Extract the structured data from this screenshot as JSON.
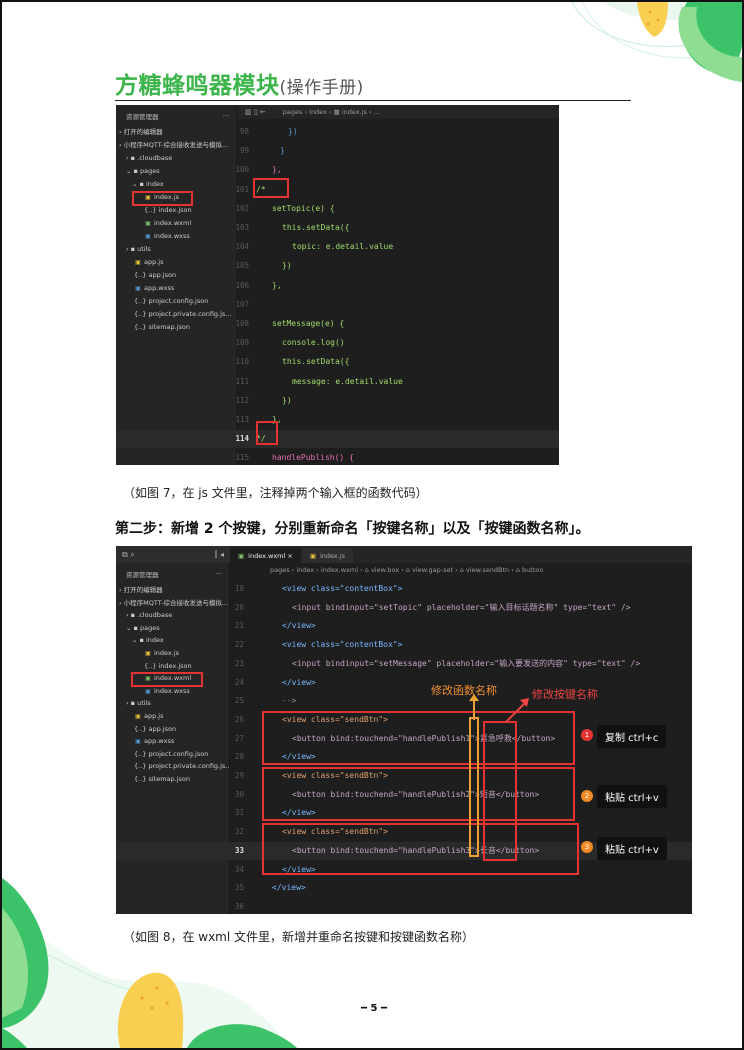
{
  "header": {
    "title": "方糖蜂鸣器模块",
    "subtitle": "(操作手册)"
  },
  "figure1": {
    "explorer_title": "资源管理器",
    "explorer_more": "···",
    "breadcrumb": "pages › index › ▦ index.js › ...",
    "tree": [
      "› 打开的编辑器",
      "› 小程序MQTT-综合接收发送与模拟...",
      "› ▪ .cloudbase",
      "⌄ ▪ pages",
      "⌄ ▪ index",
      "index.js",
      "{..} index.json",
      "index.wxml",
      "index.wxss",
      "› ▪ utils",
      "app.js",
      "{..} app.json",
      "app.wxss",
      "{..} project.config.json",
      "{..} project.private.config.js...",
      "{..} sitemap.json"
    ],
    "line_numbers": [
      "98",
      "99",
      "100",
      "101",
      "102",
      "103",
      "104",
      "105",
      "106",
      "107",
      "108",
      "109",
      "110",
      "111",
      "112",
      "113",
      "114",
      "115"
    ],
    "code": [
      "})",
      "}",
      "},",
      "/*",
      "setTopic(e) {",
      "this.setData({",
      "topic: e.detail.value",
      "})",
      "},",
      "",
      "setMessage(e) {",
      "console.log()",
      "this.setData({",
      "message: e.detail.value",
      "})",
      "},",
      "*/",
      "handlePublish() {"
    ],
    "caption": "（如图 7，在 js 文件里，注释掉两个输入框的函数代码）"
  },
  "step2": "第二步：新增 2 个按键，分别重新命名「按键名称」以及「按键函数名称」。",
  "figure2": {
    "explorer_title": "资源管理器",
    "tabs": [
      "index.wxml ×",
      "index.js"
    ],
    "breadcrumb": "pages › index › index.wxml › ⌂ view.box › ⌂ view.gap-set › ⌂ view.sendBtn › ⌂ button",
    "tree": [
      "› 打开的编辑器",
      "› 小程序MQTT-综合接收发送与模拟...",
      "› ▪ .cloudbase",
      "⌄ ▪ pages",
      "⌄ ▪ index",
      "index.js",
      "{..} index.json",
      "index.wxml",
      "index.wxss",
      "› ▪ utils",
      "app.js",
      "{..} app.json",
      "app.wxss",
      "{..} project.config.json",
      "{..} project.private.config.js...",
      "{..} sitemap.json"
    ],
    "line_numbers": [
      "19",
      "20",
      "21",
      "22",
      "23",
      "24",
      "25",
      "26",
      "27",
      "28",
      "29",
      "30",
      "31",
      "32",
      "33",
      "34",
      "35",
      "36"
    ],
    "code": [
      "<view class=\"contentBox\">",
      "<input bindinput=\"setTopic\" placeholder=\"输入目标话题名称\" type=\"text\" />",
      "</view>",
      "<view class=\"contentBox\">",
      "<input bindinput=\"setMessage\" placeholder=\"输入要发送的内容\" type=\"text\" />",
      "</view>",
      "-->",
      "<view class=\"sendBtn\">",
      "<button bind:touchend=\"handlePublish1\">紧急呼救</button>",
      "</view>",
      "<view class=\"sendBtn\">",
      "<button bind:touchend=\"handlePublish2\">短音</button>",
      "</view>",
      "<view class=\"sendBtn\">",
      "<button bind:touchend=\"handlePublish3\">长音</button>",
      "</view>",
      "</view>",
      ""
    ],
    "anno_func": "修改函数名称",
    "anno_btn": "修改按键名称",
    "callouts": [
      {
        "num": "1",
        "text": "复制 ctrl+c"
      },
      {
        "num": "2",
        "text": "粘贴 ctrl+v"
      },
      {
        "num": "3",
        "text": "粘贴 ctrl+v"
      }
    ],
    "caption": "（如图 8，在 wxml 文件里，新增并重命名按键和按键函数名称）"
  },
  "page_number": "━ 5 ━",
  "colors": {
    "brand_green": "#3bb54a",
    "highlight_red": "#e53333",
    "highlight_orange": "#f0a030"
  }
}
